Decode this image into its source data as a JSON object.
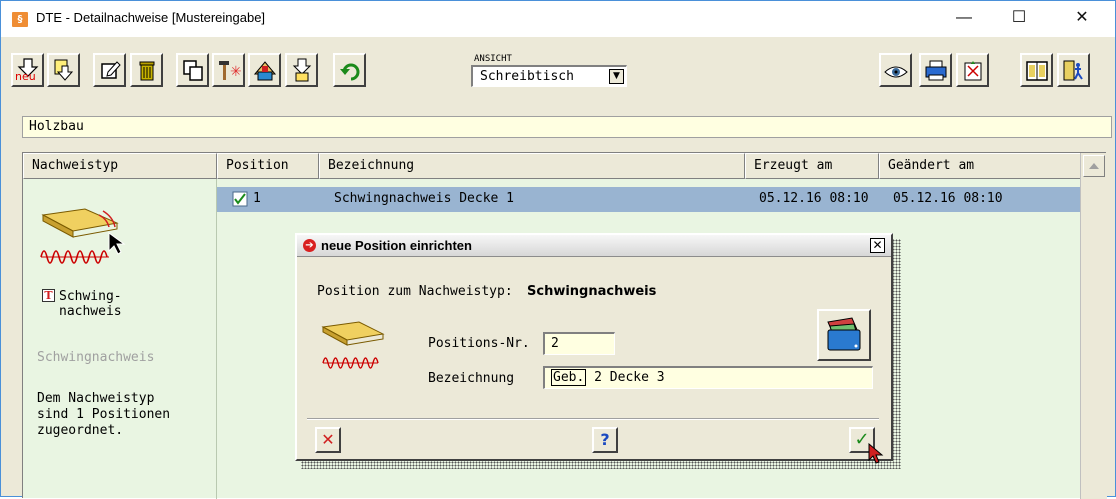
{
  "window": {
    "title": "DTE - Detailnachweise [Mustereingabe]",
    "app_icon_glyph": "§",
    "minimize_glyph": "—",
    "maximize_glyph": "☐",
    "close_glyph": "✕"
  },
  "toolbar": {
    "new_label": "neu",
    "view_label": "ANSICHT",
    "view_value": "Schreibtisch",
    "icons": [
      "new-icon",
      "open-icon",
      "edit-icon",
      "delete-icon",
      "copy-icon",
      "tools-icon",
      "output-icon",
      "import-icon",
      "undo-icon",
      "view-icon",
      "print-icon",
      "settings-icon",
      "manual-icon",
      "exit-icon"
    ]
  },
  "category": "Holzbau",
  "table": {
    "headers": {
      "type": "Nachweistyp",
      "position": "Position",
      "description": "Bezeichnung",
      "created": "Erzeugt am",
      "modified": "Geändert am"
    },
    "rows": [
      {
        "position": "1",
        "description": "Schwingnachweis Decke 1",
        "created": "05.12.16 08:10",
        "modified": "05.12.16 08:10"
      }
    ]
  },
  "left_panel": {
    "type_name_line1": "Schwing-",
    "type_name_line2": "nachweis",
    "type_title": "Schwingnachweis",
    "info_line1": "Dem Nachweistyp",
    "info_line2": "sind 1 Positionen",
    "info_line3": "zugeordnet."
  },
  "dialog": {
    "title": "neue Position einrichten",
    "type_prefix": "Position zum Nachweistyp:",
    "type_value": "Schwingnachweis",
    "pos_label": "Positions-Nr.",
    "pos_value": "2",
    "name_label": "Bezeichnung",
    "name_value_selected": "Geb.",
    "name_value_rest": " 2 Decke 3",
    "cancel_glyph": "✕",
    "help_glyph": "?",
    "ok_glyph": "✓"
  },
  "colors": {
    "selection": "#99b4d1",
    "panel_bg": "#e9f5e2",
    "input_bg": "#ffffe1"
  }
}
